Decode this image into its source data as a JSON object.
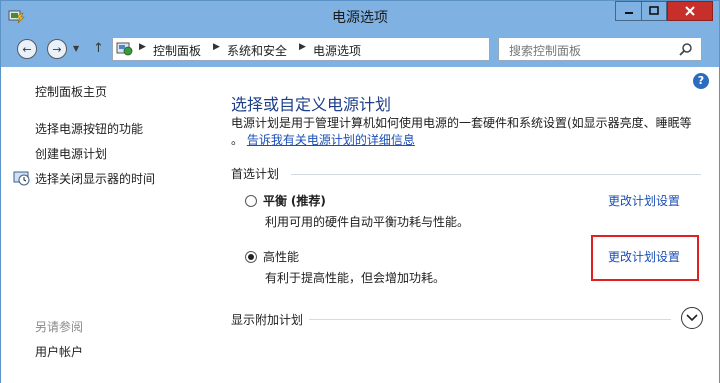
{
  "window": {
    "title": "电源选项"
  },
  "address": {
    "crumbs": [
      "控制面板",
      "系统和安全",
      "电源选项"
    ]
  },
  "search": {
    "placeholder": "搜索控制面板"
  },
  "sidebar": {
    "home": "控制面板主页",
    "links": [
      "选择电源按钮的功能",
      "创建电源计划",
      "选择关闭显示器的时间"
    ],
    "see_also_label": "另请参阅",
    "see_also_links": [
      "用户帐户"
    ]
  },
  "main": {
    "heading": "选择或自定义电源计划",
    "description": "电源计划是用于管理计算机如何使用电源的一套硬件和系统设置(如显示器亮度、睡眠等",
    "description_tail": "。",
    "description_link": "告诉我有关电源计划的详细信息",
    "preferred_label": "首选计划",
    "plans": [
      {
        "name": "平衡",
        "tag": "(推荐)",
        "description": "利用可用的硬件自动平衡功耗与性能。",
        "link": "更改计划设置",
        "selected": false
      },
      {
        "name": "高性能",
        "tag": "",
        "description": "有利于提高性能，但会增加功耗。",
        "link": "更改计划设置",
        "selected": true
      }
    ],
    "more_label": "显示附加计划"
  },
  "colors": {
    "titlebar": "#7fb2e2",
    "close": "#c7302a",
    "link": "#1a4fb5",
    "heading": "#1e3f8a",
    "highlight": "#e02020"
  }
}
